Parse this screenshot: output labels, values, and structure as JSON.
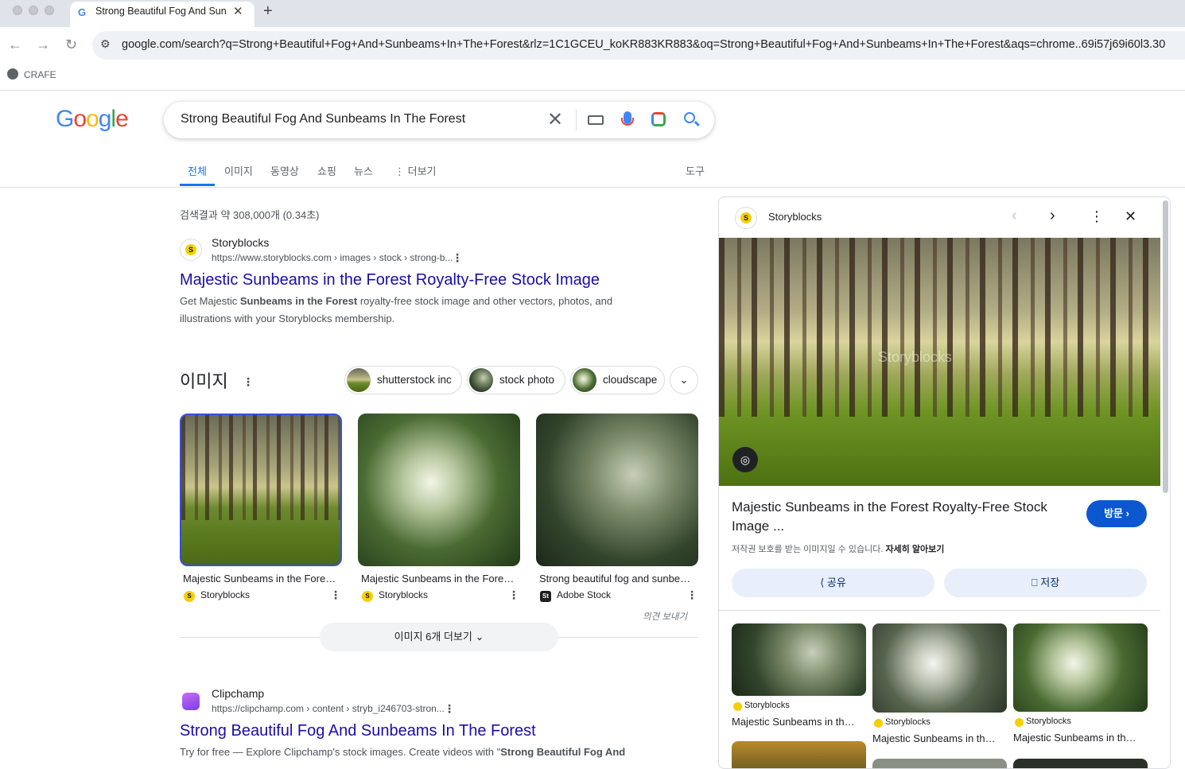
{
  "browser": {
    "tab_title": "Strong Beautiful Fog And Sun",
    "url": "google.com/search?q=Strong+Beautiful+Fog+And+Sunbeams+In+The+Forest&rlz=1C1GCEU_koKR883KR883&oq=Strong+Beautiful+Fog+And+Sunbeams+In+The+Forest&aqs=chrome..69i57j69i60l3.30",
    "bookmark": "CRAFE",
    "close_glyph": "✕",
    "newtab_glyph": "+",
    "back_glyph": "←",
    "forward_glyph": "→",
    "reload_glyph": "↻",
    "tune_glyph": "⚙"
  },
  "search": {
    "query": "Strong Beautiful Fog And Sunbeams In The Forest",
    "clear_glyph": "✕"
  },
  "logo": {
    "g1": "G",
    "o1": "o",
    "o2": "o",
    "g2": "g",
    "l": "l",
    "e": "e"
  },
  "colors": {
    "blue": "#4285f4",
    "red": "#ea4335",
    "yellow": "#fbbc05",
    "green": "#34a853",
    "link": "#1a0dab",
    "accent": "#1a73e8"
  },
  "nav_tabs": [
    {
      "label": "전체",
      "active": true
    },
    {
      "label": "이미지"
    },
    {
      "label": "동영상"
    },
    {
      "label": "쇼핑"
    },
    {
      "label": "뉴스"
    },
    {
      "label": "⋮ 더보기"
    }
  ],
  "tools_label": "도구",
  "stats": "검색결과 약 308,000개 (0.34초)",
  "result1": {
    "site": "Storyblocks",
    "cite": "https://www.storyblocks.com › images › stock › strong-b...",
    "title": "Majestic Sunbeams in the Forest Royalty-Free Stock Image",
    "snippet_pre": "Get Majestic ",
    "snippet_bold": "Sunbeams in the Forest",
    "snippet_post": " royalty-free stock image and other vectors, photos, and illustrations with your Storyblocks membership."
  },
  "images_section": {
    "heading": "이미지",
    "chips": [
      "shutterstock inc",
      "stock photo",
      "cloudscape"
    ],
    "chevron_glyph": "⌄",
    "items": [
      {
        "caption": "Majestic Sunbeams in the Fore…",
        "source": "Storyblocks"
      },
      {
        "caption": "Majestic Sunbeams in the Fore…",
        "source": "Storyblocks"
      },
      {
        "caption": "Strong beautiful fog and sunbe…",
        "source": "Adobe Stock"
      }
    ],
    "feedback": "의견 보내기",
    "more_button": "이미지 6개 더보기 ⌄"
  },
  "result2": {
    "site": "Clipchamp",
    "cite": "https://clipchamp.com › content › stryb_i246703-stron...",
    "title": "Strong Beautiful Fog And Sunbeams In The Forest",
    "snippet_pre": "Try for free — Explore Clipchamp's stock images. Create videos with \"",
    "snippet_bold": "Strong Beautiful Fog And"
  },
  "panel": {
    "site": "Storyblocks",
    "watermark": "Storyblocks",
    "title": "Majestic Sunbeams in the Forest Royalty-Free Stock Image ...",
    "visit_button": "방문 ›",
    "copyright_text": "저작권 보호를 받는 이미지일 수 있습니다. ",
    "copyright_link": "자세히 알아보기",
    "share_button": "⟨ 공유",
    "save_button": "⎕ 저장",
    "prev_glyph": "‹",
    "next_glyph": "›",
    "more_glyph": "⋮",
    "close_glyph": "✕",
    "related": [
      {
        "source": "Storyblocks",
        "caption": "Majestic Sunbeams in th…"
      },
      {
        "source": "Storyblocks",
        "caption": "Majestic Sunbeams in th…"
      },
      {
        "source": "Storyblocks",
        "caption": "Majestic Sunbeams in th…"
      }
    ]
  }
}
